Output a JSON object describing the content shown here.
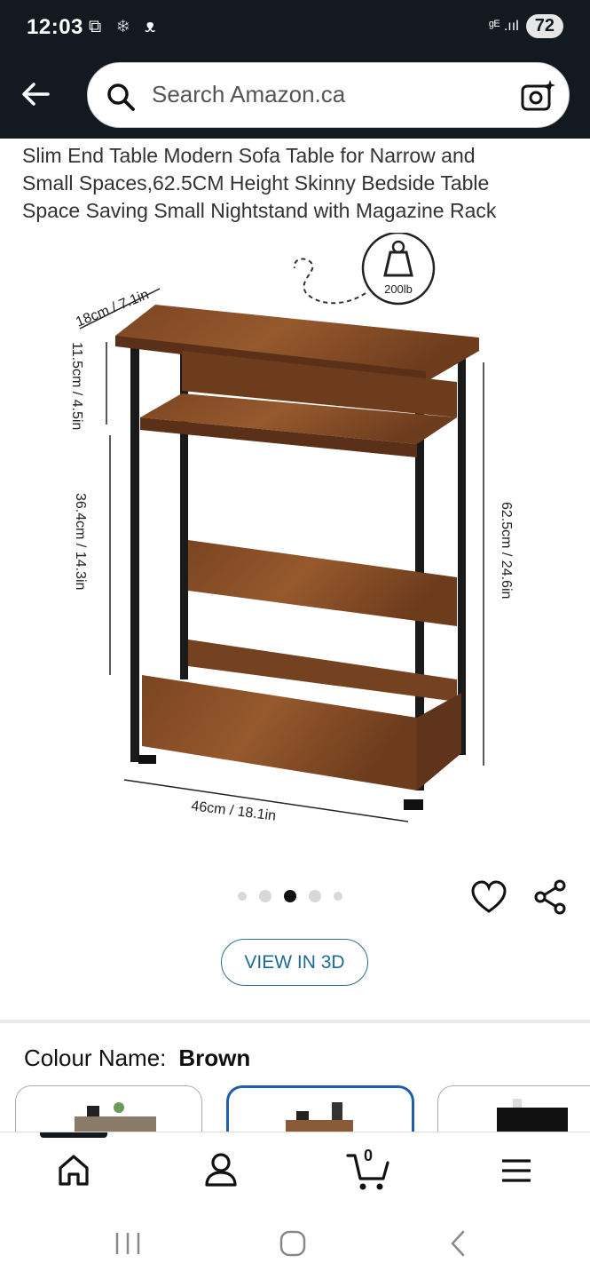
{
  "status_bar": {
    "time": "12:03",
    "left_icons": "⧉ ❄ ᴥ",
    "network": "ᵍᴱ .ııl",
    "battery": "72"
  },
  "search": {
    "placeholder": "Search Amazon.ca"
  },
  "product": {
    "title_lines": [
      "Slim End Table Modern Sofa Table for Narrow and",
      "Small Spaces,62.5CM Height Skinny Bedside Table",
      "Space Saving Small Nightstand with Magazine Rack"
    ],
    "image": {
      "weight_badge": "200lb",
      "dim_depth": "18cm / 7.1in",
      "dim_shelf_gap": "11.5cm / 4.5in",
      "dim_lower": "36.4cm / 14.3in",
      "dim_height": "62.5cm / 24.6in",
      "dim_width": "46cm / 18.1in"
    },
    "carousel": {
      "count": 5,
      "active_index": 2
    },
    "view_3d_label": "VIEW IN 3D"
  },
  "colour": {
    "label": "Colour Name:",
    "value": "Brown",
    "swatches": [
      "brown-with-top-decor",
      "brown-with-speaker",
      "black-lift-top"
    ],
    "selected_index": 1
  },
  "bottom_nav": {
    "items": [
      "home",
      "account",
      "cart",
      "menu"
    ],
    "cart_count": "0",
    "active": "home"
  },
  "colors": {
    "header_bg": "#131921",
    "link_blue": "#1b6b9a",
    "selected_border": "#1f5faa"
  }
}
